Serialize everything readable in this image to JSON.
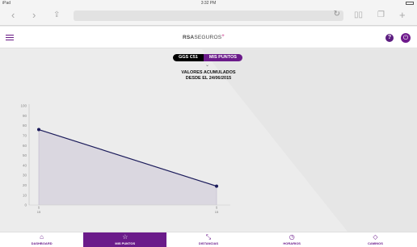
{
  "status_bar": {
    "carrier": "iPad",
    "time": "3:32 PM"
  },
  "safari": {
    "back_icon": "chevron-left-icon",
    "forward_icon": "chevron-right-icon",
    "share_icon": "share-icon",
    "reload_icon": "reload-icon",
    "bookmarks_icon": "book-icon",
    "tabs_icon": "tabs-icon",
    "new_tab_icon": "plus-icon"
  },
  "app": {
    "logo_bold": "RSA",
    "logo_light": "SEGUROS",
    "logo_mark": "+",
    "help_label": "?",
    "accent_color": "#6b1b8a"
  },
  "toggle": {
    "left": "GGS C51",
    "right": "MIS PUNTOS",
    "selected": "MIS PUNTOS"
  },
  "heading": {
    "line1": "VALORES ACUMULADOS",
    "line2": "DESDE EL 24/06/2015"
  },
  "chart_data": {
    "type": "area",
    "title": "",
    "xlabel": "",
    "ylabel": "",
    "ylim": [
      0,
      100
    ],
    "y_ticks": [
      "0",
      "10",
      "20",
      "30",
      "40",
      "50",
      "60",
      "70",
      "80",
      "90",
      "100"
    ],
    "x_ticks": [
      {
        "line1": "1",
        "line2": "15"
      },
      {
        "line1": "1",
        "line2": "15"
      }
    ],
    "series": [
      {
        "values": [
          76,
          19
        ],
        "color": "#1b1b5a"
      }
    ],
    "grid": false
  },
  "bottom_nav": [
    {
      "label": "DASHBOARD",
      "icon": "home-icon",
      "glyph": "⌂",
      "active": false
    },
    {
      "label": "MIS PUNTOS",
      "icon": "star-icon",
      "glyph": "☆",
      "active": true
    },
    {
      "label": "DISTANCIAS",
      "icon": "distance-icon",
      "glyph": "⤡",
      "active": false
    },
    {
      "label": "HORARIOS",
      "icon": "clock-icon",
      "glyph": "◷",
      "active": false
    },
    {
      "label": "CAMINOS",
      "icon": "road-sign-icon",
      "glyph": "◇",
      "active": false
    }
  ]
}
